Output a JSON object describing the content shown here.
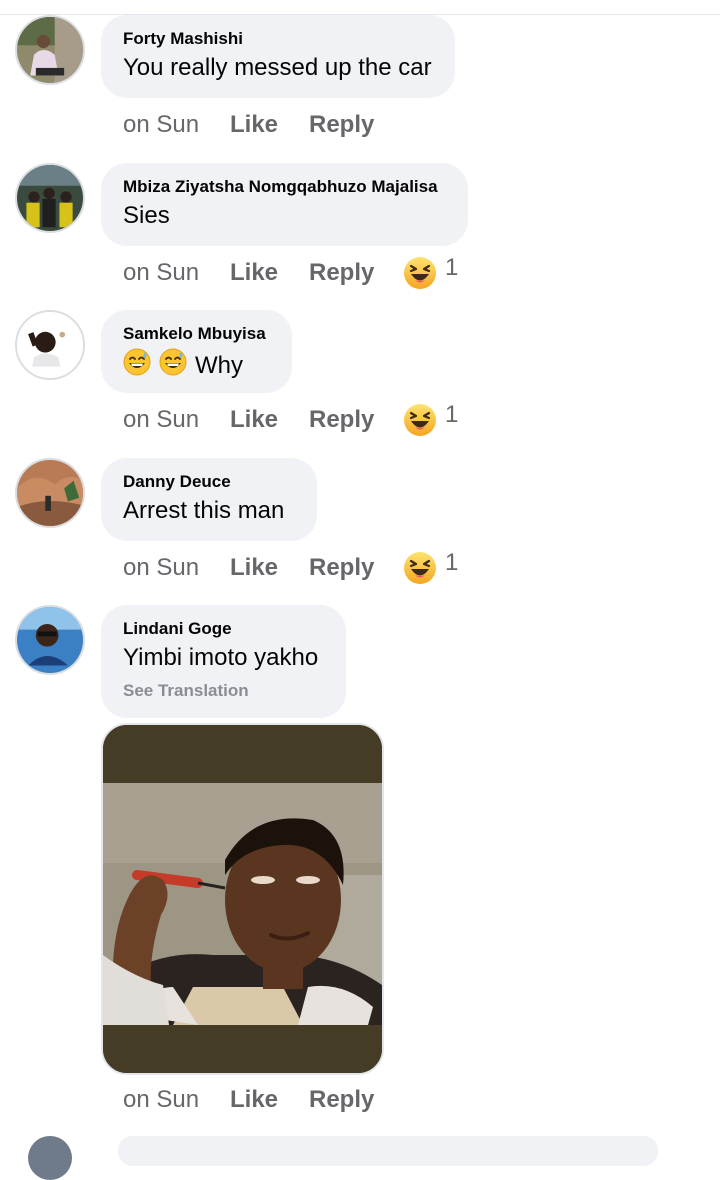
{
  "comments": [
    {
      "author": "Forty Mashishi",
      "text": "You really messed up the car",
      "time": "on Sun",
      "like": "Like",
      "reply": "Reply"
    },
    {
      "author": "Mbiza Ziyatsha Nomgqabhuzo Majalisa",
      "text": "Sies",
      "time": "on Sun",
      "like": "Like",
      "reply": "Reply",
      "reaction_icon": "haha-emoji",
      "reaction_count": "1"
    },
    {
      "author": "Samkelo Mbuyisa",
      "text": "Why",
      "text_prefix_icons": [
        "grinning-sweat-emoji",
        "grinning-sweat-emoji"
      ],
      "time": "on Sun",
      "like": "Like",
      "reply": "Reply",
      "reaction_icon": "haha-emoji",
      "reaction_count": "1"
    },
    {
      "author": "Danny Deuce",
      "text": "Arrest this man",
      "time": "on Sun",
      "like": "Like",
      "reply": "Reply",
      "reaction_icon": "haha-emoji",
      "reaction_count": "1"
    },
    {
      "author": "Lindani Goge",
      "text": "Yimbi imoto yakho",
      "see_translation": "See Translation",
      "attachment": "photo",
      "time": "on Sun",
      "like": "Like",
      "reply": "Reply"
    }
  ],
  "colors": {
    "bubble": "#f0f2f5",
    "action_text": "#65676b",
    "see_translation": "#8a8d91",
    "haha_yellow": "#f7b125"
  }
}
